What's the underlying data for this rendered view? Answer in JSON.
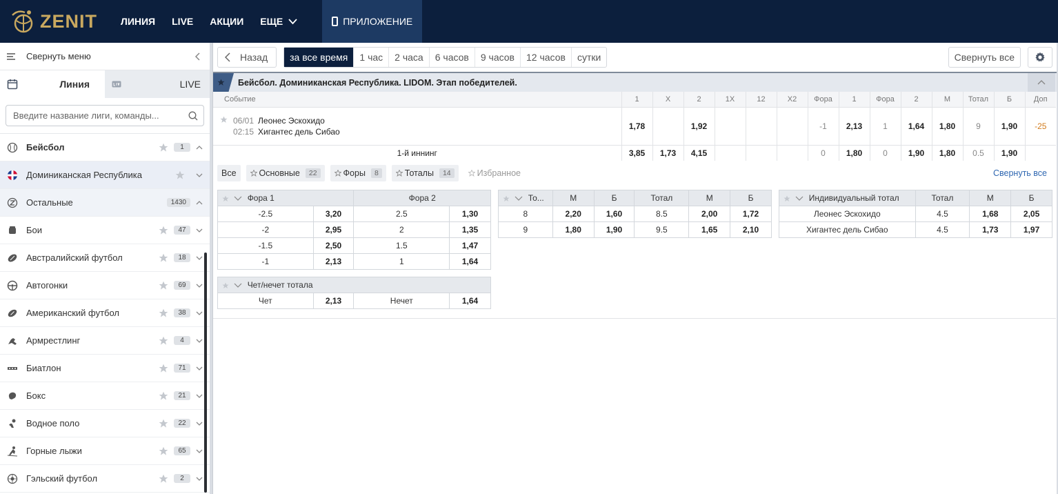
{
  "header": {
    "logo_text": "ZENIT",
    "nav": [
      "ЛИНИЯ",
      "LIVE",
      "АКЦИИ",
      "ЕЩЕ"
    ],
    "app_label": "ПРИЛОЖЕНИЕ"
  },
  "sidebar": {
    "collapse_label": "Свернуть меню",
    "tabs": [
      {
        "label": "Линия"
      },
      {
        "label": "LIVE"
      }
    ],
    "search_placeholder": "Введите название лиги, команды...",
    "items": [
      {
        "name": "Бейсбол",
        "count": "1",
        "icon": "baseball-icon"
      },
      {
        "name": "Доминиканская Республика",
        "count": "",
        "icon": "flag-dominican-icon"
      },
      {
        "name": "Остальные",
        "count": "1430",
        "icon": "other-sports-icon"
      },
      {
        "name": "Бои",
        "count": "47",
        "icon": "fight-icon"
      },
      {
        "name": "Австралийский футбол",
        "count": "18",
        "icon": "aussie-football-icon"
      },
      {
        "name": "Автогонки",
        "count": "69",
        "icon": "racing-icon"
      },
      {
        "name": "Американский футбол",
        "count": "38",
        "icon": "american-football-icon"
      },
      {
        "name": "Армрестлинг",
        "count": "4",
        "icon": "armwrestling-icon"
      },
      {
        "name": "Биатлон",
        "count": "71",
        "icon": "biathlon-icon"
      },
      {
        "name": "Бокс",
        "count": "21",
        "icon": "boxing-glove-icon"
      },
      {
        "name": "Водное поло",
        "count": "22",
        "icon": "water-polo-icon"
      },
      {
        "name": "Горные лыжи",
        "count": "65",
        "icon": "ski-icon"
      },
      {
        "name": "Гэльский футбол",
        "count": "2",
        "icon": "gaelic-football-icon"
      }
    ]
  },
  "toolbar": {
    "back_label": "Назад",
    "time_filters": [
      "за все время",
      "1 час",
      "2 часа",
      "6 часов",
      "9 часов",
      "12 часов",
      "сутки"
    ],
    "collapse_all_label": "Свернуть все"
  },
  "league": {
    "name": "Бейсбол. Доминиканская Республика. LIDOM. Этап победителей.",
    "columns": [
      "Событие",
      "1",
      "X",
      "2",
      "1X",
      "12",
      "X2",
      "Фора",
      "1",
      "Фора",
      "2",
      "М",
      "Тотал",
      "Б",
      "Доп"
    ],
    "event": {
      "date": "06/01",
      "time": "02:15",
      "team1": "Леонес Эскохидо",
      "team2": "Хигантес дель Сибао",
      "cells": [
        "1,78",
        "",
        "1,92",
        "",
        "",
        "",
        "-1",
        "2,13",
        "1",
        "1,64",
        "1,80",
        "9",
        "1,90",
        "-25"
      ]
    },
    "sub": {
      "label": "1-й иннинг",
      "cells": [
        "3,85",
        "1,73",
        "4,15",
        "",
        "",
        "",
        "0",
        "1,80",
        "0",
        "1,90",
        "1,80",
        "0.5",
        "1,90",
        ""
      ]
    }
  },
  "market_tabs": [
    {
      "label": "Все",
      "count": ""
    },
    {
      "label": "Основные",
      "count": "22"
    },
    {
      "label": "Форы",
      "count": "8"
    },
    {
      "label": "Тоталы",
      "count": "14"
    },
    {
      "label": "Избранное",
      "count": ""
    }
  ],
  "collapse_link": "Свернуть все",
  "fora": {
    "headers": [
      "Фора 1",
      "Фора 2"
    ],
    "rows": [
      [
        "-2.5",
        "3,20",
        "2.5",
        "1,30"
      ],
      [
        "-2",
        "2,95",
        "2",
        "1,35"
      ],
      [
        "-1.5",
        "2,50",
        "1.5",
        "1,47"
      ],
      [
        "-1",
        "2,13",
        "1",
        "1,64"
      ]
    ]
  },
  "totals": {
    "headers": [
      "То...",
      "М",
      "Б",
      "Тотал",
      "М",
      "Б"
    ],
    "rows": [
      [
        "8",
        "2,20",
        "1,60",
        "8.5",
        "2,00",
        "1,72"
      ],
      [
        "9",
        "1,80",
        "1,90",
        "9.5",
        "1,65",
        "2,10"
      ]
    ]
  },
  "indtotal": {
    "headers": [
      "Индивидуальный тотал",
      "Тотал",
      "М",
      "Б"
    ],
    "rows": [
      [
        "Леонес Эскохидо",
        "4.5",
        "1,68",
        "2,05"
      ],
      [
        "Хигантес дель Сибао",
        "4.5",
        "1,73",
        "1,97"
      ]
    ]
  },
  "evenodd": {
    "header": "Чет/нечет тотала",
    "row": [
      "Чет",
      "2,13",
      "Нечет",
      "1,64"
    ]
  },
  "colors": {
    "header_bg": "#0c1f3d",
    "logo_gold": "#c9a85f",
    "accent_orange": "#d27c1e",
    "link_blue": "#2f67b1"
  }
}
